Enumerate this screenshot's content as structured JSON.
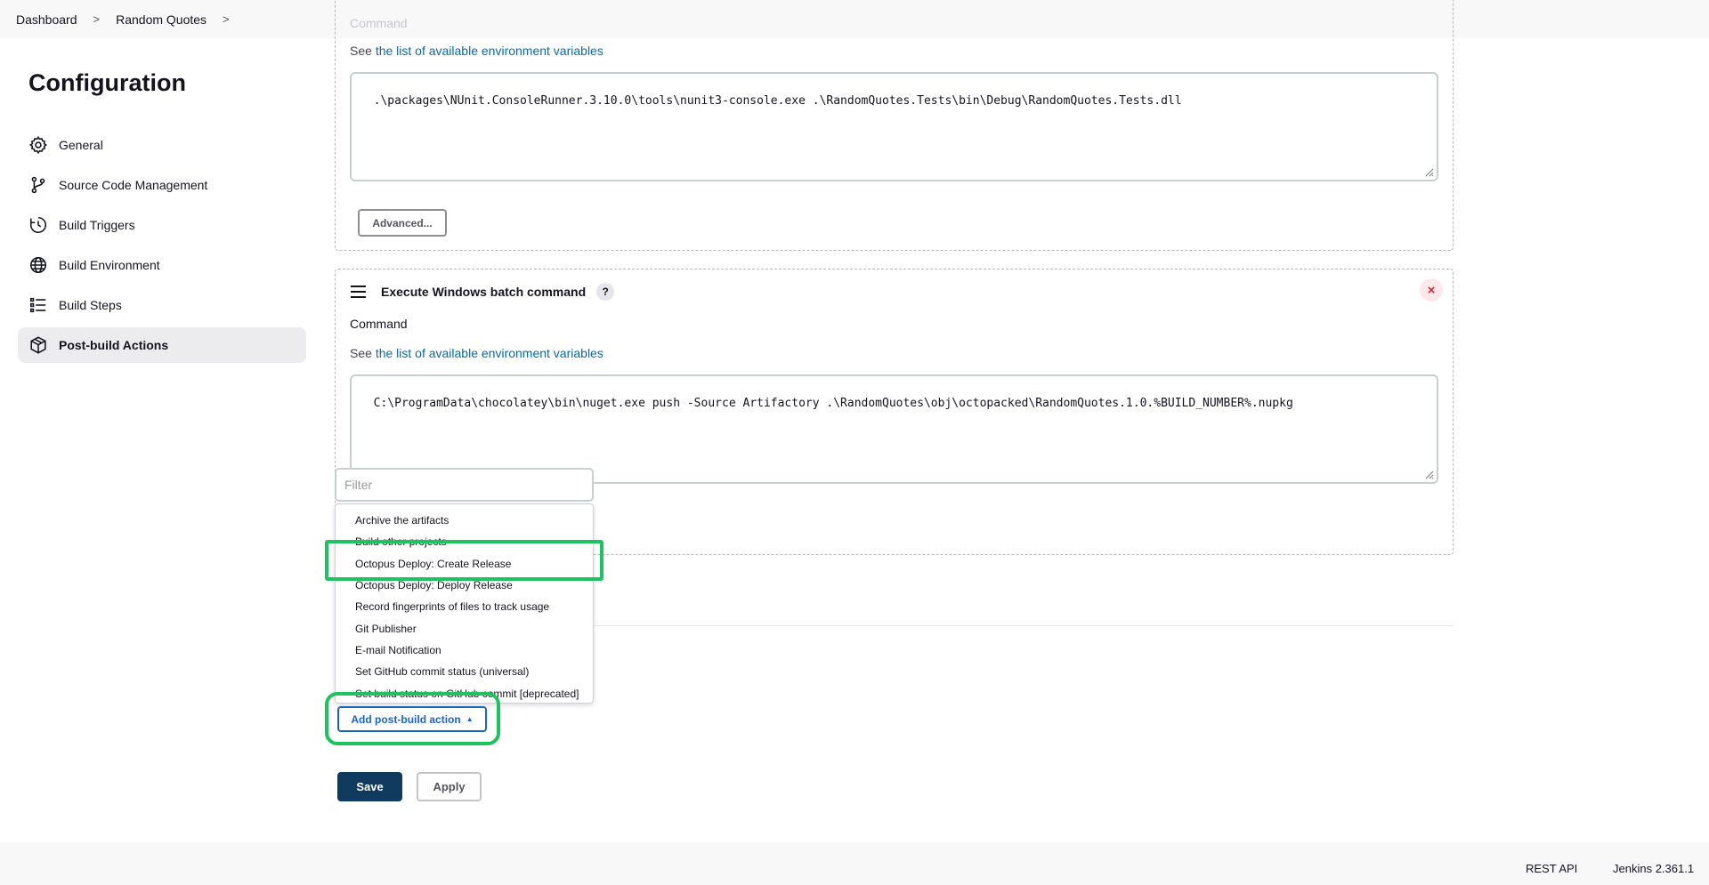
{
  "breadcrumb": {
    "items": [
      "Dashboard",
      "Random Quotes"
    ],
    "separator": ">"
  },
  "sidebar": {
    "title": "Configuration",
    "items": [
      {
        "label": "General",
        "icon": "gear-icon"
      },
      {
        "label": "Source Code Management",
        "icon": "branch-icon"
      },
      {
        "label": "Build Triggers",
        "icon": "clock-icon"
      },
      {
        "label": "Build Environment",
        "icon": "globe-icon"
      },
      {
        "label": "Build Steps",
        "icon": "list-icon"
      },
      {
        "label": "Post-build Actions",
        "icon": "package-icon",
        "active": true
      }
    ]
  },
  "step1": {
    "label_partial": "Command",
    "see_prefix": "See ",
    "see_link": "the list of available environment variables",
    "command": ".\\packages\\NUnit.ConsoleRunner.3.10.0\\tools\\nunit3-console.exe .\\RandomQuotes.Tests\\bin\\Debug\\RandomQuotes.Tests.dll",
    "advanced_label": "Advanced..."
  },
  "step2": {
    "title": "Execute Windows batch command",
    "help": "?",
    "close": "×",
    "label": "Command",
    "see_prefix": "See ",
    "see_link": "the list of available environment variables",
    "command": "C:\\ProgramData\\chocolatey\\bin\\nuget.exe push -Source Artifactory .\\RandomQuotes\\obj\\octopacked\\RandomQuotes.1.0.%BUILD_NUMBER%.nupkg"
  },
  "dropdown": {
    "filter_placeholder": "Filter",
    "items": [
      "Archive the artifacts",
      "Build other projects",
      "Octopus Deploy: Create Release",
      "Octopus Deploy: Deploy Release",
      "Record fingerprints of files to track usage",
      "Git Publisher",
      "E-mail Notification",
      "Set GitHub commit status (universal)",
      "Set build status on GitHub commit [deprecated]"
    ],
    "highlighted_index": 2
  },
  "actions": {
    "add_label": "Add post-build action",
    "save_label": "Save",
    "apply_label": "Apply"
  },
  "footer": {
    "rest_api": "REST API",
    "version": "Jenkins 2.361.1"
  },
  "colors": {
    "link": "#0b6aa2",
    "highlight": "#1ec25f",
    "save_bg": "#103a5e",
    "add_btn": "#1864c8",
    "close_red": "#e0213b"
  }
}
